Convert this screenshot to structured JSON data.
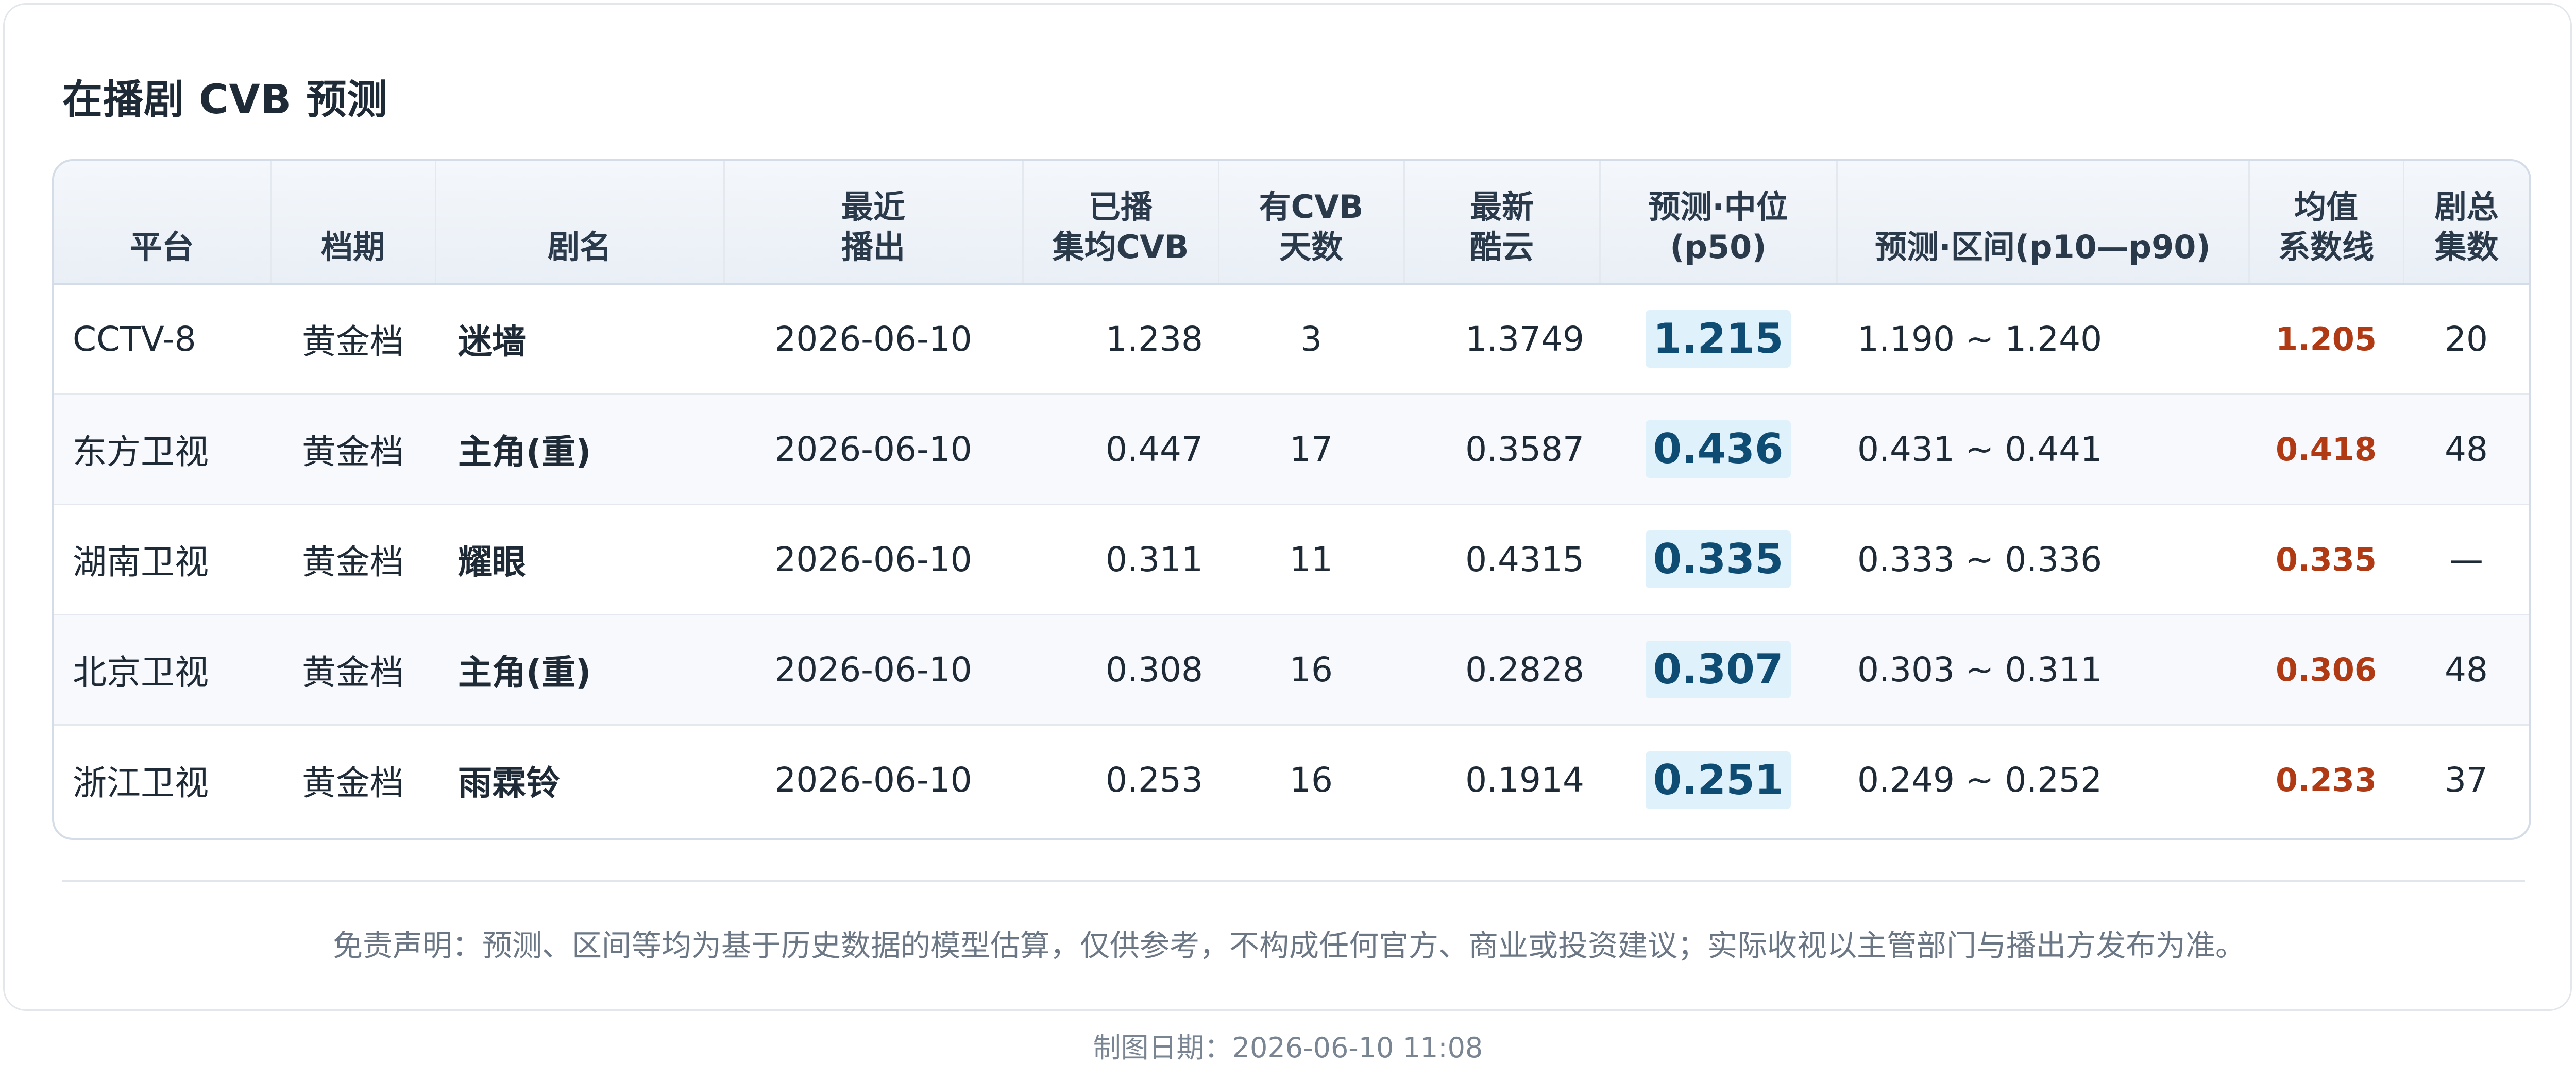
{
  "title": "在播剧 CVB 预测",
  "table": {
    "headers": [
      "平台",
      "档期",
      "剧名",
      "最近\n播出",
      "已播\n集均CVB",
      "有CVB\n天数",
      "最新\n酷云",
      "预测·中位\n(p50)",
      "预测·区间(p10—p90)",
      "均值\n系数线",
      "剧总\n集数"
    ],
    "rows": [
      {
        "platform": "CCTV-8",
        "slot": "黄金档",
        "drama": "迷墙",
        "last_air": "2026-06-10",
        "avg_cvb": "1.238",
        "cvb_days": "3",
        "kuyun": "1.3749",
        "p50": "1.215",
        "range": "1.190 ~ 1.240",
        "mean_line": "1.205",
        "total_eps": "20"
      },
      {
        "platform": "东方卫视",
        "slot": "黄金档",
        "drama": "主角(重)",
        "last_air": "2026-06-10",
        "avg_cvb": "0.447",
        "cvb_days": "17",
        "kuyun": "0.3587",
        "p50": "0.436",
        "range": "0.431 ~ 0.441",
        "mean_line": "0.418",
        "total_eps": "48"
      },
      {
        "platform": "湖南卫视",
        "slot": "黄金档",
        "drama": "耀眼",
        "last_air": "2026-06-10",
        "avg_cvb": "0.311",
        "cvb_days": "11",
        "kuyun": "0.4315",
        "p50": "0.335",
        "range": "0.333 ~ 0.336",
        "mean_line": "0.335",
        "total_eps": "—"
      },
      {
        "platform": "北京卫视",
        "slot": "黄金档",
        "drama": "主角(重)",
        "last_air": "2026-06-10",
        "avg_cvb": "0.308",
        "cvb_days": "16",
        "kuyun": "0.2828",
        "p50": "0.307",
        "range": "0.303 ~ 0.311",
        "mean_line": "0.306",
        "total_eps": "48"
      },
      {
        "platform": "浙江卫视",
        "slot": "黄金档",
        "drama": "雨霖铃",
        "last_air": "2026-06-10",
        "avg_cvb": "0.253",
        "cvb_days": "16",
        "kuyun": "0.1914",
        "p50": "0.251",
        "range": "0.249 ~ 0.252",
        "mean_line": "0.233",
        "total_eps": "37"
      }
    ]
  },
  "disclaimer": "免责声明：预测、区间等均为基于历史数据的模型估算，仅供参考，不构成任何官方、商业或投资建议；实际收视以主管部门与播出方发布为准。",
  "footer": "制图日期：2026-06-10 11:08",
  "colors": {
    "mean_line": "#b03a14",
    "p50_text": "#0f4c73",
    "p50_bg": "#dff1fb",
    "header_bg": "#e9eff6"
  }
}
